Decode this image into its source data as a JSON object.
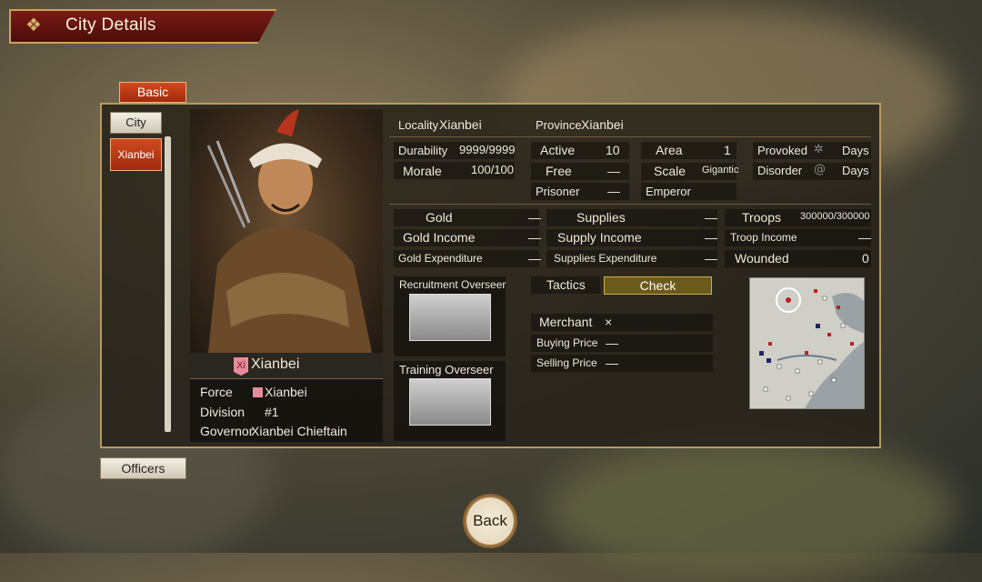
{
  "title": "City Details",
  "tab_basic": "Basic",
  "sidebar": {
    "city_btn": "City",
    "selected_city": "Xianbei",
    "officers_btn": "Officers"
  },
  "officer": {
    "flag_char": "Xi",
    "name": "Xianbei",
    "force_label": "Force",
    "force_value": "Xianbei",
    "force_color": "#e58c9a",
    "division_label": "Division",
    "division_value": "#1",
    "governor_label": "Governor",
    "governor_value": "Xianbei Chieftain"
  },
  "location": {
    "locality_label": "Locality",
    "locality_value": "Xianbei",
    "province_label": "Province",
    "province_value": "Xianbei"
  },
  "stats": {
    "durability_label": "Durability",
    "durability_value": "9999/9999",
    "morale_label": "Morale",
    "morale_value": "100/100",
    "active_label": "Active",
    "active_value": "10",
    "free_label": "Free",
    "free_value": "—",
    "prisoner_label": "Prisoner",
    "prisoner_value": "—",
    "area_label": "Area",
    "area_value": "1",
    "scale_label": "Scale",
    "scale_value": "Gigantic",
    "emperor_label": "Emperor",
    "emperor_value": "",
    "provoked_label": "Provoked",
    "provoked_unit": "Days",
    "disorder_label": "Disorder",
    "disorder_unit": "Days"
  },
  "economy": {
    "gold_label": "Gold",
    "gold_value": "—",
    "gold_income_label": "Gold Income",
    "gold_income_value": "—",
    "gold_exp_label": "Gold Expenditure",
    "gold_exp_value": "—",
    "supplies_label": "Supplies",
    "supplies_value": "—",
    "supply_income_label": "Supply Income",
    "supply_income_value": "—",
    "supplies_exp_label": "Supplies Expenditure",
    "supplies_exp_value": "—",
    "troops_label": "Troops",
    "troops_value": "300000/300000",
    "troop_income_label": "Troop Income",
    "troop_income_value": "—",
    "wounded_label": "Wounded",
    "wounded_value": "0"
  },
  "overseers": {
    "recruitment": "Recruitment Overseer",
    "training": "Training Overseer"
  },
  "tactics": {
    "label": "Tactics",
    "check": "Check"
  },
  "merchant": {
    "label": "Merchant",
    "value": "×",
    "buying_label": "Buying Price",
    "buying_value": "—",
    "selling_label": "Selling Price",
    "selling_value": "—"
  },
  "back": "Back"
}
